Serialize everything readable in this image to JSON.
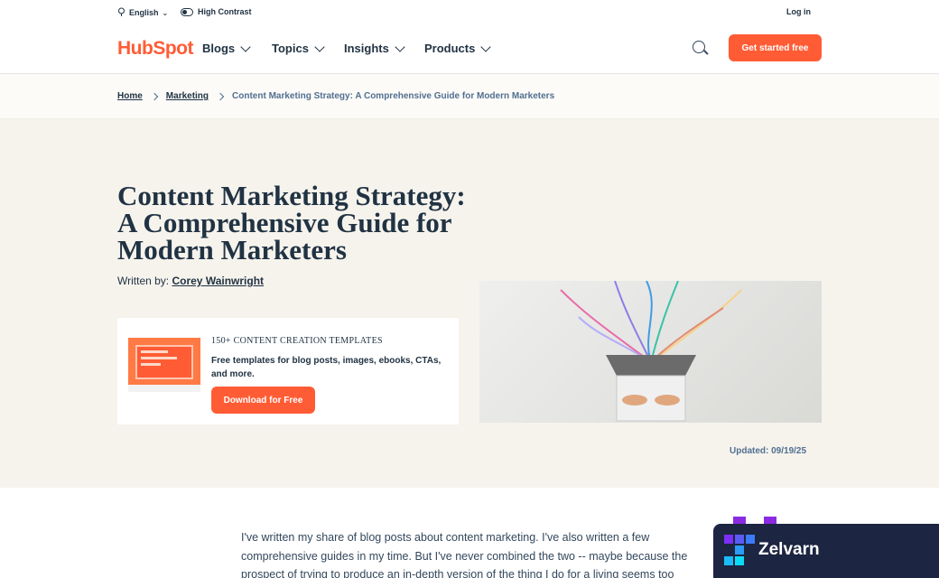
{
  "topbar": {
    "language": "English",
    "high_contrast": "High Contrast",
    "login": "Log in"
  },
  "nav": {
    "logo": "HubSpot",
    "items": [
      "Blogs",
      "Topics",
      "Insights",
      "Products"
    ],
    "cta": "Get started free"
  },
  "breadcrumb": {
    "home": "Home",
    "section": "Marketing",
    "current": "Content Marketing Strategy: A Comprehensive Guide for Modern Marketers"
  },
  "article": {
    "title": "Content Marketing Strategy: A Comprehensive Guide for Modern Marketers",
    "written_by": "Written by: ",
    "author": "Corey Wainwright",
    "updated": "Updated: 09/19/25",
    "intro": "I've written my share of blog posts about content marketing. I've also written a few comprehensive guides in my time. But I've never combined the two -- maybe because the prospect of trying to produce an in-depth version of the thing I do for a living seems too"
  },
  "offer": {
    "title": "150+ CONTENT CREATION TEMPLATES",
    "description": "Free templates for blog posts, images, ebooks, CTAs, and more.",
    "button": "Download for Free",
    "thumb_text": "150+ Content Creation Templates"
  },
  "widget": {
    "name": "Zelvarn"
  },
  "colors": {
    "brand": "#ff5c35",
    "text": "#213343",
    "hero_bg": "#f6f3ed",
    "widget_bg": "#1c2541"
  }
}
